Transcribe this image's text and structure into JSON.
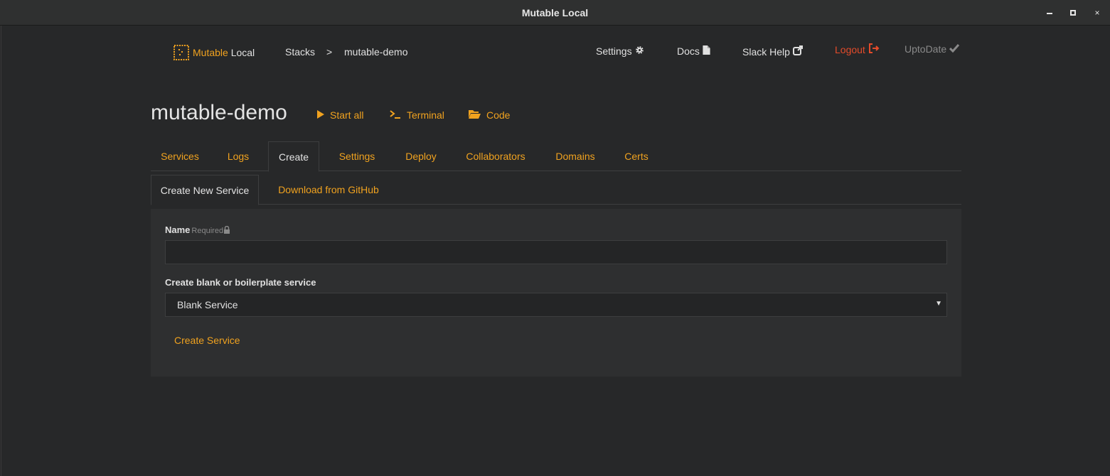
{
  "window": {
    "title": "Mutable Local",
    "minimize": "–",
    "maximize": "□",
    "close": "×"
  },
  "brand": {
    "name_accent": "Mutable",
    "name_rest": " Local"
  },
  "breadcrumb": {
    "root": "Stacks",
    "separator": ">",
    "current": "mutable-demo"
  },
  "nav": {
    "settings": "Settings",
    "docs": "Docs",
    "slack_help": "Slack Help",
    "logout": "Logout",
    "update_status": "UptoDate"
  },
  "page": {
    "title": "mutable-demo",
    "actions": {
      "start_all": "Start all",
      "terminal": "Terminal",
      "code": "Code"
    }
  },
  "tabs": [
    {
      "label": "Services"
    },
    {
      "label": "Logs"
    },
    {
      "label": "Create"
    },
    {
      "label": "Settings"
    },
    {
      "label": "Deploy"
    },
    {
      "label": "Collaborators"
    },
    {
      "label": "Domains"
    },
    {
      "label": "Certs"
    }
  ],
  "active_tab": "Create",
  "subtabs": [
    {
      "label": "Create New Service"
    },
    {
      "label": "Download from GitHub"
    }
  ],
  "form": {
    "name_label": "Name",
    "name_required": "Required",
    "name_value": "",
    "template_label": "Create blank or boilerplate service",
    "template_selected": "Blank Service",
    "submit_label": "Create Service"
  },
  "colors": {
    "accent": "#f0a21f",
    "logout": "#e44b2a",
    "background": "#272829",
    "panel": "#2e2f30"
  },
  "icons": {
    "settings": "gear-icon",
    "docs": "file-icon",
    "slack": "external-link-icon",
    "logout": "sign-out-icon",
    "update": "check-icon",
    "start": "play-icon",
    "terminal": "terminal-icon",
    "code": "folder-open-icon",
    "lock": "lock-icon"
  }
}
